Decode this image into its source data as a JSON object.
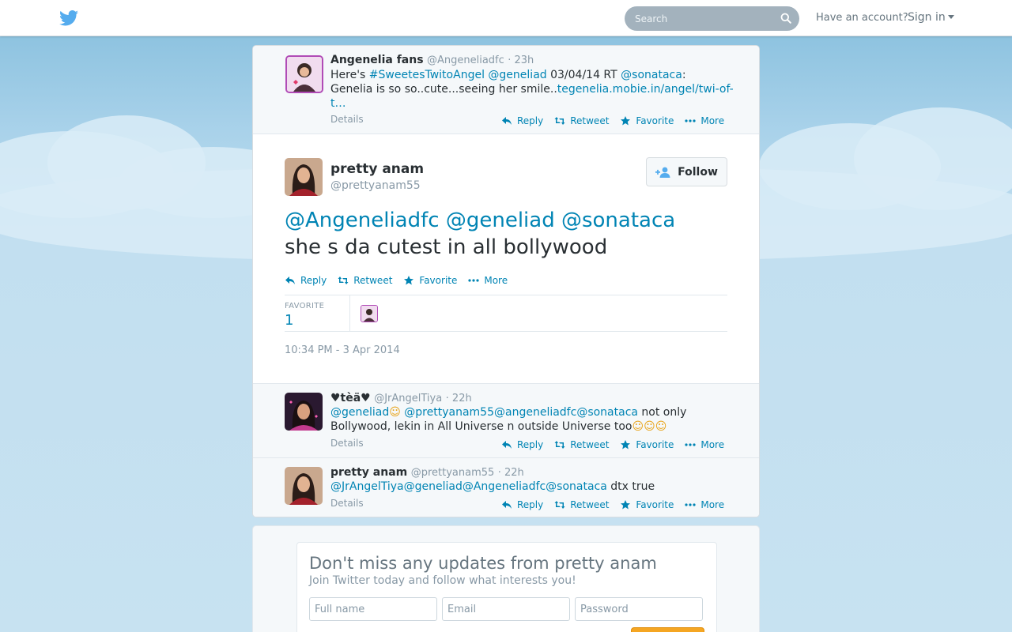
{
  "header": {
    "search_placeholder": "Search",
    "have_account": "Have an account?",
    "sign_in": "Sign in"
  },
  "colors": {
    "link": "#0084b4",
    "text": "#292f33",
    "muted": "#8899a6",
    "brand": "#55acee"
  },
  "actions": {
    "reply": "Reply",
    "retweet": "Retweet",
    "favorite": "Favorite",
    "more": "More"
  },
  "tweets": {
    "parent": {
      "name": "Angenelia fans",
      "handle": "@Angeneliadfc",
      "time": "· 23h",
      "text_parts": [
        "Here's ",
        "#SweetesTwitoAngel",
        " ",
        "@geneliad",
        " 03/04/14 RT ",
        "@sonataca",
        ":",
        "Genelia is so so..cute...seeing her smile..",
        "tegenelia.mobie.in/angel/twi-of-t",
        "…"
      ],
      "details": "Details"
    },
    "main": {
      "name": "pretty anam",
      "handle": "@prettyanam55",
      "follow": "Follow",
      "mentions": [
        "@Angeneliadfc",
        "@geneliad",
        "@sonataca"
      ],
      "text": "she s da cutest in all bollywood",
      "stat_label": "FAVORITE",
      "stat_value": "1",
      "timestamp": "10:34 PM - 3 Apr 2014"
    },
    "reply1": {
      "name": "♥tèä♥",
      "handle": "@JrAngelTiya",
      "time": "· 22h",
      "mentions": [
        "@geneliad",
        "@prettyanam55",
        "@angeneliadfc",
        "@sonataca"
      ],
      "emoji": "☺",
      "text_a": " not only",
      "text_b": "Bollywood, lekin in All Universe n outside Universe too",
      "details": "Details"
    },
    "reply2": {
      "name": "pretty anam",
      "handle": "@prettyanam55",
      "time": "· 22h",
      "mentions": [
        "@JrAngelTiya",
        "@geneliad",
        "@Angeneliadfc",
        "@sonataca"
      ],
      "text": " dtx true",
      "details": "Details"
    }
  },
  "signup": {
    "title": "Don't miss any updates from pretty anam",
    "subtitle": "Join Twitter today and follow what interests you!",
    "full_name_placeholder": "Full name",
    "email_placeholder": "Email",
    "password_placeholder": "Password"
  }
}
